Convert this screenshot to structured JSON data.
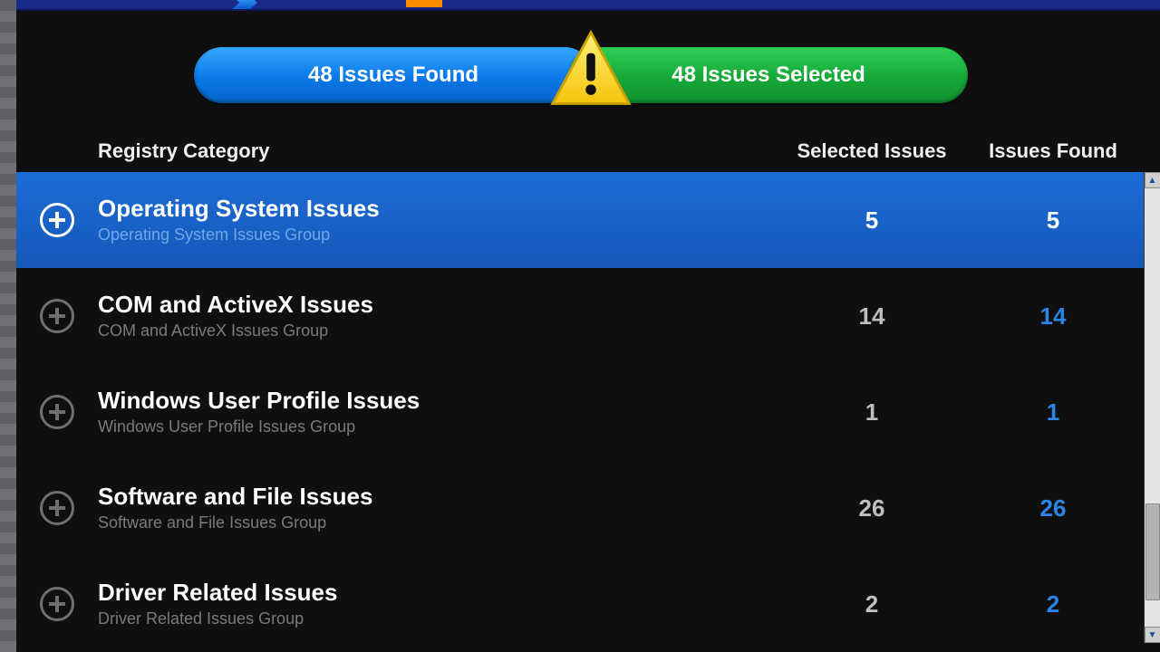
{
  "summary": {
    "found_label": "48 Issues Found",
    "selected_label": "48 Issues Selected"
  },
  "columns": {
    "category": "Registry Category",
    "selected": "Selected Issues",
    "found": "Issues Found"
  },
  "rows": [
    {
      "title": "Operating System Issues",
      "subtitle": "Operating System Issues Group",
      "selected": "5",
      "found": "5",
      "highlight": true
    },
    {
      "title": "COM and ActiveX Issues",
      "subtitle": "COM and ActiveX Issues Group",
      "selected": "14",
      "found": "14",
      "highlight": false
    },
    {
      "title": "Windows User Profile Issues",
      "subtitle": "Windows User Profile Issues Group",
      "selected": "1",
      "found": "1",
      "highlight": false
    },
    {
      "title": "Software and File Issues",
      "subtitle": "Software and File Issues Group",
      "selected": "26",
      "found": "26",
      "highlight": false
    },
    {
      "title": "Driver Related Issues",
      "subtitle": "Driver Related Issues Group",
      "selected": "2",
      "found": "2",
      "highlight": false
    }
  ],
  "scrollbar": {
    "thumb_top_pct": 72,
    "thumb_height_pct": 22
  }
}
